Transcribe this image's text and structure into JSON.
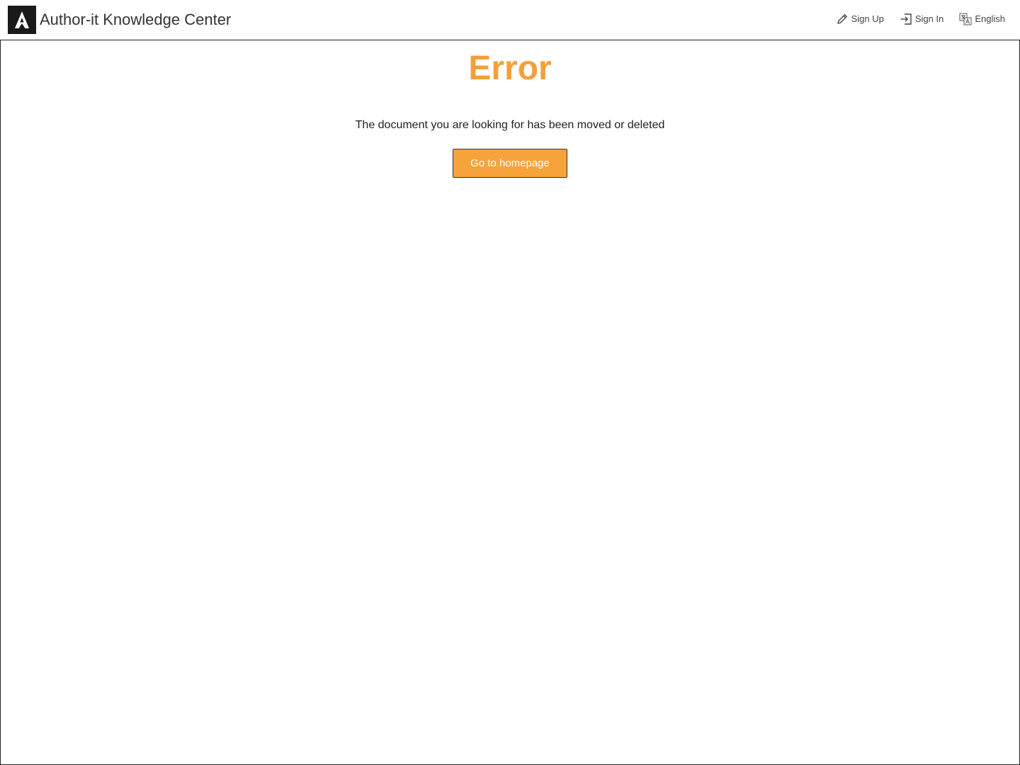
{
  "header": {
    "logo_icon": "author-it-logo-icon",
    "title": "Author-it Knowledge Center",
    "nav": {
      "sign_up": {
        "label": "Sign Up",
        "icon": "pencil-icon"
      },
      "sign_in": {
        "label": "Sign In",
        "icon": "sign-in-icon"
      },
      "language": {
        "label": "English",
        "icon": "translate-icon"
      }
    }
  },
  "main": {
    "title": "Error",
    "message": "The document you are looking for has been moved or deleted",
    "button_label": "Go to homepage"
  },
  "colors": {
    "accent": "#f4a03a",
    "button_bg": "#f7a33b",
    "logo_bg": "#1a1a1a"
  }
}
